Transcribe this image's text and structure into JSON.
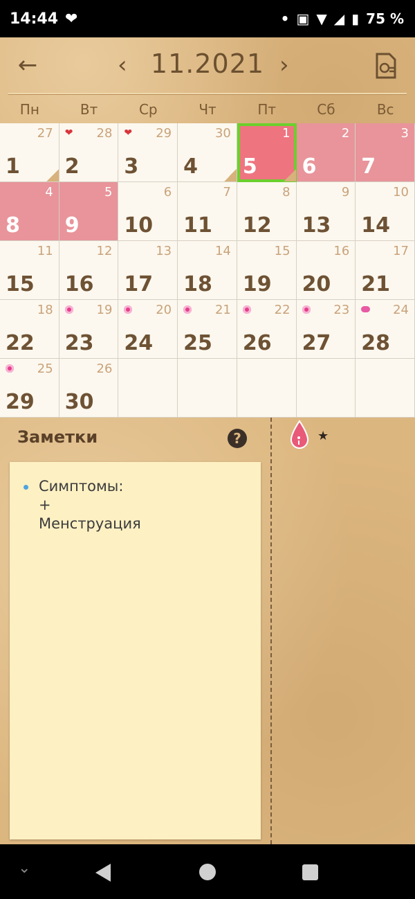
{
  "status_bar": {
    "time": "14:44",
    "battery": "75 %"
  },
  "header": {
    "month_title": "11.2021"
  },
  "weekdays": [
    "Пн",
    "Вт",
    "Ср",
    "Чт",
    "Пт",
    "Сб",
    "Вс"
  ],
  "calendar": [
    {
      "day": "1",
      "cycle": "27"
    },
    {
      "day": "2",
      "cycle": "28"
    },
    {
      "day": "3",
      "cycle": "29"
    },
    {
      "day": "4",
      "cycle": "30"
    },
    {
      "day": "5",
      "cycle": "1"
    },
    {
      "day": "6",
      "cycle": "2"
    },
    {
      "day": "7",
      "cycle": "3"
    },
    {
      "day": "8",
      "cycle": "4"
    },
    {
      "day": "9",
      "cycle": "5"
    },
    {
      "day": "10",
      "cycle": "6"
    },
    {
      "day": "11",
      "cycle": "7"
    },
    {
      "day": "12",
      "cycle": "8"
    },
    {
      "day": "13",
      "cycle": "9"
    },
    {
      "day": "14",
      "cycle": "10"
    },
    {
      "day": "15",
      "cycle": "11"
    },
    {
      "day": "16",
      "cycle": "12"
    },
    {
      "day": "17",
      "cycle": "13"
    },
    {
      "day": "18",
      "cycle": "14"
    },
    {
      "day": "19",
      "cycle": "15"
    },
    {
      "day": "20",
      "cycle": "16"
    },
    {
      "day": "21",
      "cycle": "17"
    },
    {
      "day": "22",
      "cycle": "18"
    },
    {
      "day": "23",
      "cycle": "19"
    },
    {
      "day": "24",
      "cycle": "20"
    },
    {
      "day": "25",
      "cycle": "21"
    },
    {
      "day": "26",
      "cycle": "22"
    },
    {
      "day": "27",
      "cycle": "23"
    },
    {
      "day": "28",
      "cycle": "24"
    },
    {
      "day": "29",
      "cycle": "25"
    },
    {
      "day": "30",
      "cycle": "26"
    }
  ],
  "notes": {
    "title": "Заметки",
    "content": "Симптомы:\n+\nМенструация"
  }
}
